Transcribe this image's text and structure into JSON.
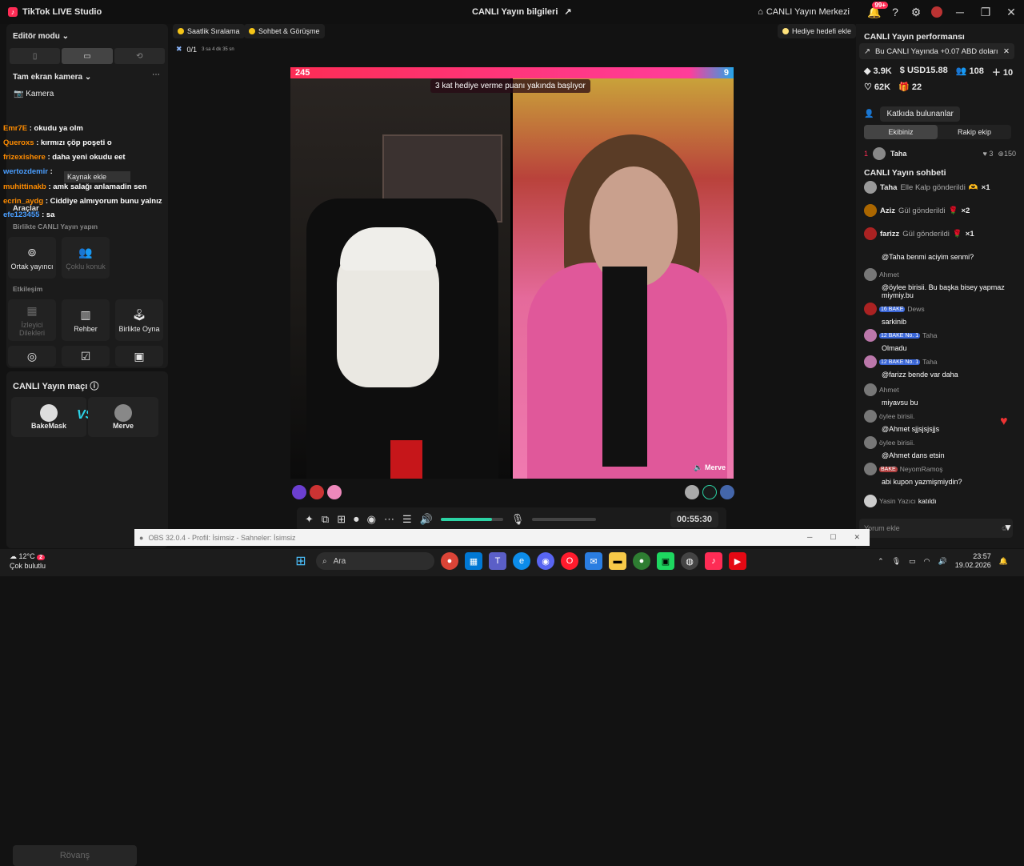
{
  "app": {
    "title": "TikTok LIVE Studio",
    "center_title": "CANLI Yayın bilgileri",
    "hub": "CANLI Yayın Merkezi",
    "notif_count": "99+"
  },
  "left": {
    "editor_mode": "Editör modu",
    "camera_section": "Tam ekran kamera",
    "camera_item": "Kamera",
    "chat": [
      {
        "user": "Emr7E",
        "text": ": okudu ya olm"
      },
      {
        "user": "Queroxs",
        "text": ": kırmızı çöp poşeti o"
      },
      {
        "user": "frizexishere",
        "text": ": daha yeni okudu eet"
      },
      {
        "user": "wertozdemir",
        "text": ":"
      },
      {
        "user": "muhittinakb",
        "text": ": amk salağı anlamadin sen"
      },
      {
        "user": "ecrin_aydg",
        "text": ": Ciddiye almıyorum bunu yalnız"
      },
      {
        "user": "efe123455",
        "text": ": sa"
      }
    ],
    "tooltip": "Kaynak ekle",
    "tools_title": "Araçlar",
    "collab_title": "Birlikte CANLI Yayın yapın",
    "collab_tools": [
      "Ortak yayıncı",
      "Çoklu konuk"
    ],
    "interact_title": "Etkileşim",
    "interact_tools": [
      "İzleyici Dilekleri",
      "Rehber",
      "Birlikte Oyna"
    ],
    "match_title": "CANLI Yayın maçı",
    "match_left": "BakeMask",
    "match_right": "Merve",
    "vs": "VS",
    "rematch": "Rövanş"
  },
  "center": {
    "chip1": "Saatlik Sıralama",
    "chip2": "Sohbet & Görüşme",
    "chip3": "Hediye hedefi ekle",
    "goal": "0/1",
    "goal_time": "3 sa 4 dk 35 sn",
    "score_left": "245",
    "score_right": "9",
    "banner": "3 kat hediye verme puanı yakında başlıyor",
    "right_name": "Merve",
    "timer": "00:55:30",
    "volume_level": 0.82
  },
  "right": {
    "perf_title": "CANLI Yayın performansı",
    "promo": "Bu CANLI Yayında +0.07 ABD doları",
    "stats1": [
      "3.9K",
      "USD15.88",
      "108",
      "10"
    ],
    "stats2": [
      "62K",
      "22"
    ],
    "contributors": "Katkıda bulunanlar",
    "tab_team": "Ekibiniz",
    "tab_rival": "Rakip ekip",
    "rank": "1",
    "rank_name": "Taha",
    "rank_hearts": "3",
    "rank_score": "150",
    "chat_title": "CANLI Yayın sohbeti",
    "gifts": [
      {
        "user": "Taha",
        "text": "Elle Kalp gönderildi",
        "count": "×1"
      },
      {
        "user": "Aziz",
        "text": "Gül gönderildi",
        "count": "×2"
      },
      {
        "user": "farizz",
        "text": "Gül gönderildi",
        "count": "×1"
      }
    ],
    "partial_msg": "@Taha benmi aciyim senmi?",
    "messages": [
      {
        "user": "Ahmet",
        "badges": "",
        "text": "@öylee birisii. Bu başka bisey yapmaz miymiy.bu"
      },
      {
        "user": "Dews",
        "badges": "16 BAKE",
        "text": "sarkinib"
      },
      {
        "user": "Taha",
        "badges": "12 BAKE No. 1",
        "text": "Olmadu"
      },
      {
        "user": "Taha",
        "badges": "12 BAKE No. 1",
        "text": "@farizz bende var daha"
      },
      {
        "user": "Ahmet",
        "badges": "",
        "text": "miyavsu bu"
      },
      {
        "user": "öylee birisii.",
        "badges": "",
        "text": "@Ahmet sjjsjsjsjjs"
      },
      {
        "user": "öylee birisii.",
        "badges": "",
        "text": "@Ahmet dans etsin"
      },
      {
        "user": "NeyomRamoş",
        "badges": "BAKE",
        "text": "abi kupon yazmişmiydin?"
      }
    ],
    "joined_user": "Yasin Yazıcı",
    "joined_text": "katıldı",
    "comment_placeholder": "Yorum ekle"
  },
  "obs": {
    "title": "OBS 32.0.4 - Profil: İsimsiz - Sahneler: İsimsiz"
  },
  "taskbar": {
    "temp": "12°C",
    "weather": "Çok bulutlu",
    "search": "Ara",
    "time": "23:57",
    "date": "19.02.2026",
    "weather_badge": "2"
  },
  "colors": {
    "accent": "#fe2c55",
    "teal": "#2bd3a4",
    "bg": "#121212"
  }
}
